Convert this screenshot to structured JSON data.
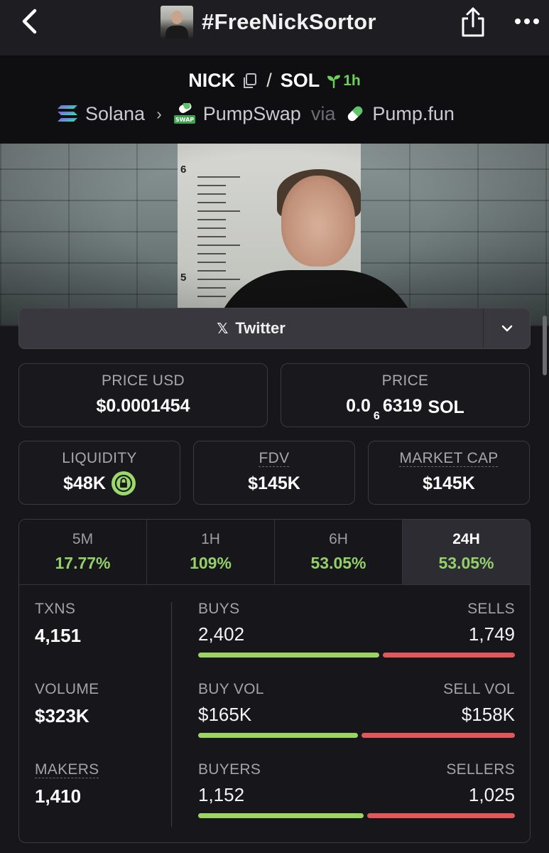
{
  "nav": {
    "title": "#FreeNickSortor",
    "back_icon": "chevron-left-icon",
    "share_icon": "share-icon",
    "more_icon": "more-horizontal-icon"
  },
  "pair": {
    "base": "NICK",
    "separator": "/",
    "quote": "SOL",
    "age": "1h",
    "chain": "Solana",
    "dex": "PumpSwap",
    "via_label": "via",
    "launchpad": "Pump.fun"
  },
  "socials": {
    "twitter_label": "Twitter"
  },
  "price_usd": {
    "label": "PRICE USD",
    "value": "$0.0001454"
  },
  "price_native": {
    "label": "PRICE",
    "prefix": "0.0",
    "zero_count": "6",
    "digits": "6319",
    "unit": "SOL"
  },
  "liquidity": {
    "label": "LIQUIDITY",
    "value": "$48K",
    "locked": true
  },
  "fdv": {
    "label": "FDV",
    "value": "$145K"
  },
  "market_cap": {
    "label": "MARKET CAP",
    "value": "$145K"
  },
  "periods": [
    {
      "label": "5M",
      "change": "17.77%"
    },
    {
      "label": "1H",
      "change": "109%"
    },
    {
      "label": "6H",
      "change": "53.05%"
    },
    {
      "label": "24H",
      "change": "53.05%"
    }
  ],
  "active_period": "24H",
  "stats": {
    "txns": {
      "label": "TXNS",
      "value": "4,151"
    },
    "volume": {
      "label": "VOLUME",
      "value": "$323K"
    },
    "makers": {
      "label": "MAKERS",
      "value": "1,410"
    }
  },
  "ratios": {
    "txns": {
      "left_label": "BUYS",
      "right_label": "SELLS",
      "left_value": "2,402",
      "right_value": "1,749",
      "left_share": 0.579
    },
    "volume": {
      "left_label": "BUY VOL",
      "right_label": "SELL VOL",
      "left_value": "$165K",
      "right_value": "$158K",
      "left_share": 0.511
    },
    "makers": {
      "left_label": "BUYERS",
      "right_label": "SELLERS",
      "left_value": "1,152",
      "right_value": "1,025",
      "left_share": 0.529
    }
  },
  "colors": {
    "accent_green": "#94d06a",
    "buy_green": "#9cd461",
    "sell_red": "#e0585a",
    "background": "#16161b"
  }
}
